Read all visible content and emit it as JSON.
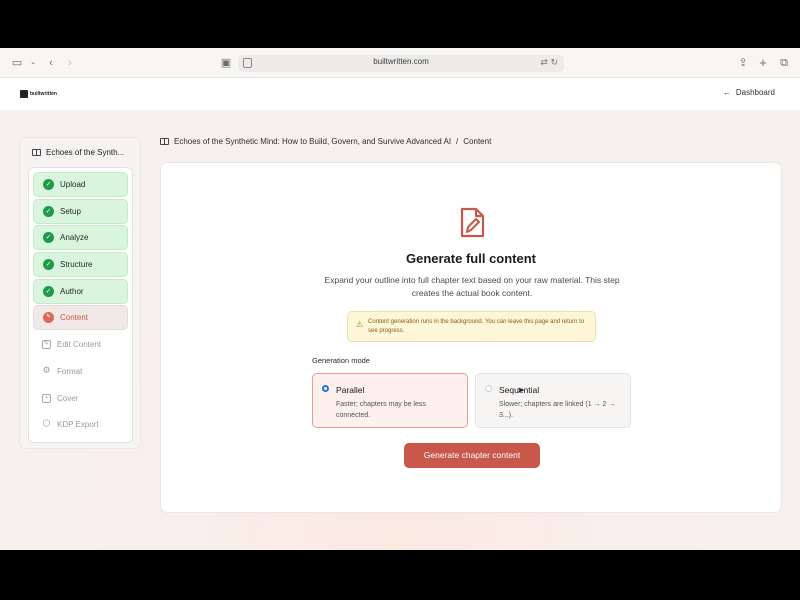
{
  "browser": {
    "url": "builtwritten.com"
  },
  "app": {
    "logo_text": "builtwritten",
    "dashboard_link": "Dashboard"
  },
  "sidebar": {
    "book_title": "Echoes of the Synth...",
    "steps": [
      {
        "label": "Upload",
        "state": "done"
      },
      {
        "label": "Setup",
        "state": "done"
      },
      {
        "label": "Analyze",
        "state": "done"
      },
      {
        "label": "Structure",
        "state": "done"
      },
      {
        "label": "Author",
        "state": "done"
      },
      {
        "label": "Content",
        "state": "current"
      },
      {
        "label": "Edit Content",
        "state": "todo"
      },
      {
        "label": "Format",
        "state": "todo"
      },
      {
        "label": "Cover",
        "state": "todo"
      },
      {
        "label": "KDP Export",
        "state": "todo"
      }
    ]
  },
  "breadcrumb": {
    "book": "Echoes of the Synthetic Mind: How to Build, Govern, and Survive Advanced AI",
    "separator": "/",
    "current": "Content"
  },
  "main": {
    "heading": "Generate full content",
    "description": "Expand your outline into full chapter text based on your raw material. This step creates the actual book content.",
    "notice": "Content generation runs in the background. You can leave this page and return to see progress.",
    "mode_label": "Generation mode",
    "options": [
      {
        "title": "Parallel",
        "subtitle": "Faster; chapters may be less connected.",
        "selected": true
      },
      {
        "title": "Sequential",
        "subtitle": "Slower; chapters are linked (1 → 2 → 3...).",
        "selected": false
      }
    ],
    "generate_button": "Generate chapter content"
  },
  "colors": {
    "accent": "#c9574a",
    "done": "#1e9a49",
    "radio": "#2b72d6"
  }
}
